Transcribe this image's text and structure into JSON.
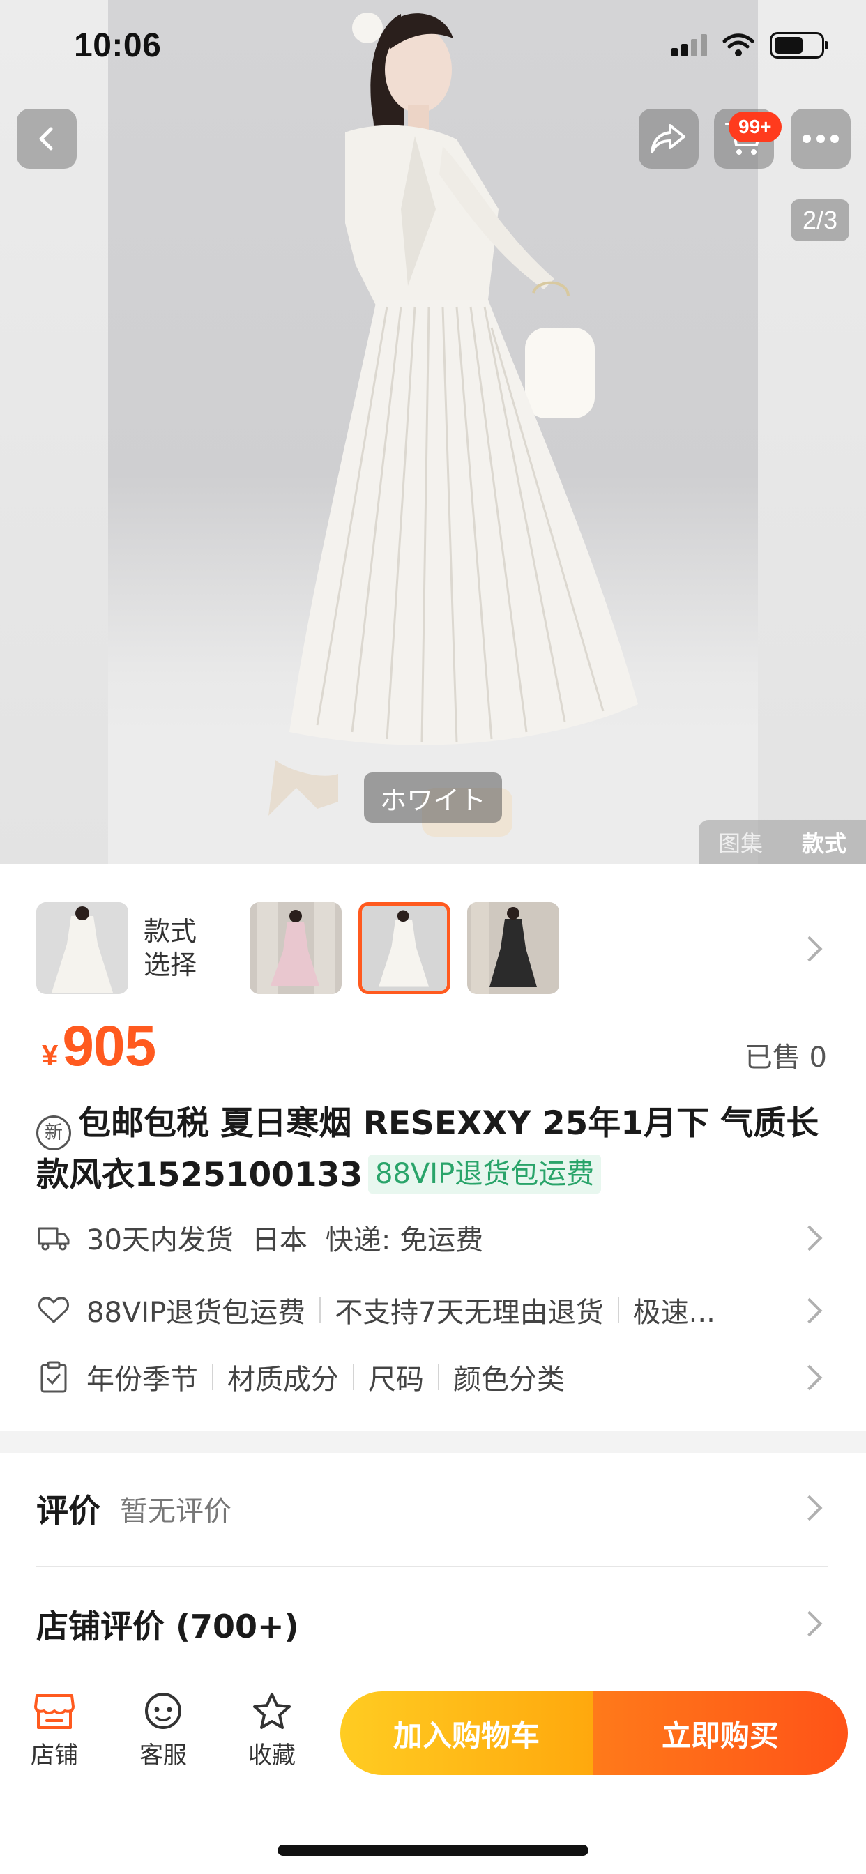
{
  "status_bar": {
    "time": "10:06"
  },
  "header": {
    "cart_badge": "99+"
  },
  "gallery": {
    "counter": "2/3",
    "color_caption": "ホワイト",
    "tabs": [
      "图集",
      "款式"
    ]
  },
  "style_selector": {
    "label": "款式\n选择"
  },
  "product": {
    "currency": "¥",
    "price": "905",
    "sold": "已售 0",
    "new_badge": "新",
    "title": "包邮包税 夏日寒烟 RESEXXY 25年1月下 气质长款风衣1525100133",
    "vip_tag": "88VIP退货包运费"
  },
  "shipping": {
    "items": [
      "30天内发货",
      "日本",
      "快递: 免运费"
    ]
  },
  "service": {
    "items": [
      "88VIP退货包运费",
      "不支持7天无理由退货",
      "极速..."
    ]
  },
  "params": {
    "items": [
      "年份季节",
      "材质成分",
      "尺码",
      "颜色分类"
    ]
  },
  "reviews": {
    "title": "评价",
    "subtitle": "暂无评价"
  },
  "shop_reviews": {
    "title": "店铺评价 (700+)"
  },
  "bottom_nav": {
    "shop": "店铺",
    "service": "客服",
    "favorite": "收藏",
    "add_to_cart": "加入购物车",
    "buy_now": "立即购买"
  },
  "colors": {
    "accent": "#ff5a1f",
    "vip_green": "#2aa46a",
    "cta_yellow": "#ffb81a",
    "cta_orange": "#ff5a1a"
  }
}
